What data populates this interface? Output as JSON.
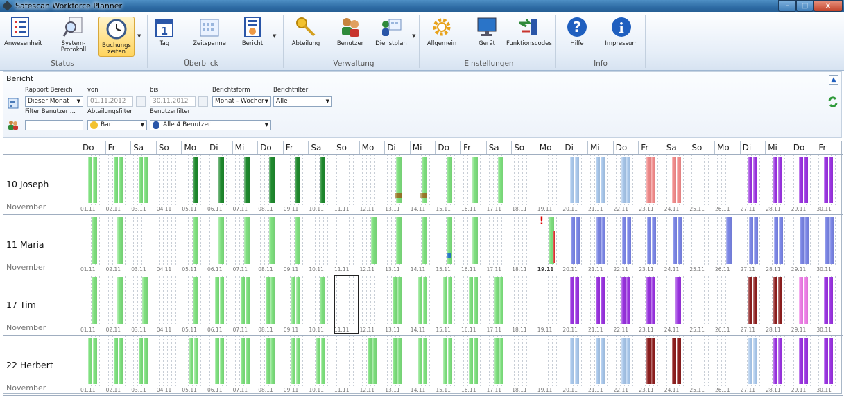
{
  "window": {
    "title": "Safescan Workforce Planner",
    "min": "–",
    "max": "□",
    "close": "x"
  },
  "ribbon": {
    "groups": [
      {
        "label": "Status",
        "items": [
          "Anwesenheit",
          "System-\nProtokoll",
          "Buchungs\nzeiten"
        ]
      },
      {
        "label": "Überblick",
        "items": [
          "Tag",
          "Zeitspanne",
          "Bericht"
        ]
      },
      {
        "label": "Verwaltung",
        "items": [
          "Abteilung",
          "Benutzer",
          "Dienstplan"
        ]
      },
      {
        "label": "Einstellungen",
        "items": [
          "Allgemein",
          "Gerät",
          "Funktionscodes"
        ]
      },
      {
        "label": "Info",
        "items": [
          "Hilfe",
          "Impressum"
        ]
      }
    ],
    "active_item": "Buchungs\nzeiten"
  },
  "panel": {
    "title": "Bericht",
    "rapport_bereich_label": "Rapport Bereich",
    "rapport_bereich_value": "Dieser Monat",
    "von_label": "von",
    "von_value": "01.11.2012",
    "bis_label": "bis",
    "bis_value": "30.11.2012",
    "berichtsform_label": "Berichtsform",
    "berichtsform_value": "Monat - Wocher",
    "berichtfilter_label": "Berichtfilter",
    "berichtfilter_value": "Alle",
    "filter_benutzer_label": "Filter Benutzer ...",
    "filter_benutzer_value": "",
    "abteilungsfilter_label": "Abteilungsfilter",
    "abteilungsfilter_value": "Bar",
    "benutzerfilter_label": "Benutzerfilter",
    "benutzerfilter_value": "Alle 4 Benutzer"
  },
  "days": [
    "Do",
    "Fr",
    "Sa",
    "So",
    "Mo",
    "Di",
    "Mi",
    "Do",
    "Fr",
    "Sa",
    "So",
    "Mo",
    "Di",
    "Mi",
    "Do",
    "Fr",
    "Sa",
    "So",
    "Mo",
    "Di",
    "Mi",
    "Do",
    "Fr",
    "Sa",
    "So",
    "Mo",
    "Di",
    "Mi",
    "Do",
    "Fr"
  ],
  "dates": [
    "01.11",
    "02.11",
    "03.11",
    "04.11",
    "05.11",
    "06.11",
    "07.11",
    "08.11",
    "09.11",
    "10.11",
    "11.11",
    "12.11",
    "13.11",
    "14.11",
    "15.11",
    "16.11",
    "17.11",
    "18.11",
    "19.11",
    "20.11",
    "21.11",
    "22.11",
    "23.11",
    "24.11",
    "25.11",
    "26.11",
    "27.11",
    "28.11",
    "29.11",
    "30.11"
  ],
  "colors": {
    "light_green": "#7ee07e",
    "dark_green": "#1f8a2e",
    "light_blue": "#a9c8ec",
    "blue": "#7b86e6",
    "purple": "#9a33e0",
    "salmon": "#f28b8b",
    "maroon": "#8e1f1f",
    "pink": "#ee7ee6",
    "olive": "#9a7a2a"
  },
  "rows": [
    {
      "name": "10 Joseph",
      "month": "November",
      "days": [
        "lg2",
        "lg2",
        "lg2",
        "",
        "dg1",
        "dg1",
        "dg1",
        "dg1",
        "dg1",
        "dg1",
        "",
        "",
        "lg1o",
        "lg1o",
        "lg1",
        "lg1",
        "lg1",
        "",
        "",
        "lb2",
        "lb2",
        "lb2",
        "sa2",
        "sa2",
        "",
        "",
        "pu2",
        "pu2",
        "pu2",
        "pu2"
      ]
    },
    {
      "name": "11 Maria",
      "month": "November",
      "days": [
        "lg1",
        "lg1",
        "",
        "",
        "lg1",
        "lg1",
        "lg1",
        "lg1",
        "lg1",
        "",
        "",
        "lg1",
        "lg1",
        "lg1",
        "lg1b",
        "lg1",
        "",
        "",
        "lg1x",
        "bl2",
        "bl2",
        "bl2",
        "bl2",
        "bl2",
        "",
        "bl1",
        "bl2",
        "bl2",
        "bl2",
        "bl2"
      ]
    },
    {
      "name": "17 Tim",
      "month": "November",
      "days": [
        "lg1",
        "lg1",
        "lg1",
        "",
        "lg1",
        "lg2",
        "lg2",
        "lg2",
        "lg2",
        "lg1",
        "sel",
        "",
        "lg2",
        "lg2",
        "lg2",
        "lg2",
        "lg2",
        "",
        "",
        "pu2",
        "pu2",
        "pu2",
        "pu2",
        "pu1",
        "",
        "",
        "mr2",
        "mr2",
        "pk2",
        "pu2"
      ]
    },
    {
      "name": "22 Herbert",
      "month": "November",
      "days": [
        "lg2",
        "lg2",
        "lg2",
        "",
        "lg2",
        "lg2",
        "lg2",
        "lg2",
        "lg2",
        "lg2",
        "",
        "lg2",
        "lg2",
        "lg2",
        "lg2",
        "lg2",
        "lg2",
        "",
        "",
        "lb2",
        "lb2",
        "lb2",
        "mr2",
        "mr2",
        "",
        "",
        "lb2",
        "pu2",
        "pu2",
        "pu2"
      ]
    }
  ]
}
